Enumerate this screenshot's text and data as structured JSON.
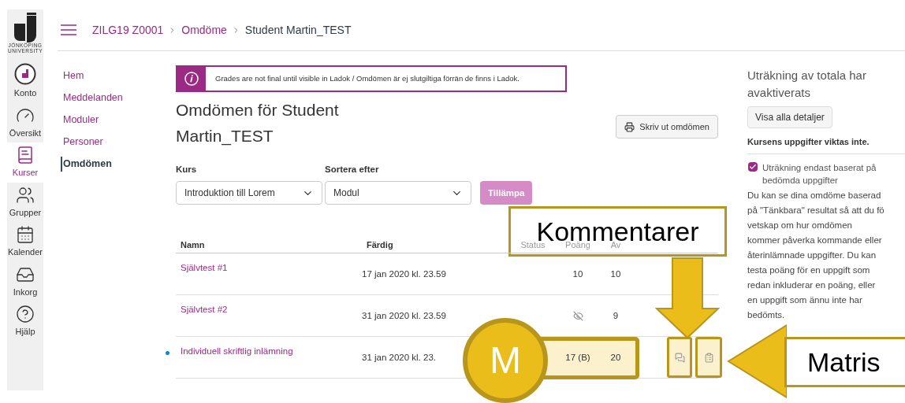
{
  "logo": {
    "lines": [
      "JÖNKÖPING",
      "UNIVERSITY"
    ]
  },
  "global_nav": [
    {
      "label": "Konto",
      "kind": "account",
      "selected": false
    },
    {
      "label": "Översikt",
      "kind": "dashboard",
      "selected": false
    },
    {
      "label": "Kurser",
      "kind": "courses",
      "selected": true
    },
    {
      "label": "Grupper",
      "kind": "groups",
      "selected": false
    },
    {
      "label": "Kalender",
      "kind": "calendar",
      "selected": false
    },
    {
      "label": "Inkorg",
      "kind": "inbox",
      "selected": false
    },
    {
      "label": "Hjälp",
      "kind": "help",
      "selected": false
    }
  ],
  "breadcrumb": [
    {
      "label": "ZILG19 Z0001",
      "link": true
    },
    {
      "label": "Omdöme",
      "link": true
    },
    {
      "label": "Student Martin_TEST",
      "link": false
    }
  ],
  "course_nav": [
    {
      "label": "Hem",
      "selected": false
    },
    {
      "label": "Meddelanden",
      "selected": false
    },
    {
      "label": "Moduler",
      "selected": false
    },
    {
      "label": "Personer",
      "selected": false
    },
    {
      "label": "Omdömen",
      "selected": true
    }
  ],
  "banner": {
    "text": "Grades are not final until visible in Ladok / Omdömen är ej slutgiltiga förrän de finns i Ladok."
  },
  "title": "Omdömen för Student Martin_TEST",
  "print_button": "Skriv ut omdömen",
  "filters": [
    {
      "label": "Kurs",
      "value": "Introduktion till Lorem"
    },
    {
      "label": "Sortera efter",
      "value": "Modul"
    }
  ],
  "apply_button": "Tillämpa",
  "table": {
    "columns": [
      "Namn",
      "Färdig",
      "Status",
      "Poäng",
      "Av"
    ],
    "rows": [
      {
        "name": "Självtest #1",
        "due": "17 jan 2020 kl. 23.59",
        "kind": "text",
        "score": "10",
        "out_of": "10",
        "unread": false,
        "highlighted": false,
        "icons": false
      },
      {
        "name": "Självtest #2",
        "due": "31 jan 2020 kl. 23.59",
        "kind": "hidden",
        "out_of": "9",
        "unread": false,
        "highlighted": false,
        "icons": false
      },
      {
        "name": "Individuell skriftlig inlämning",
        "due": "31 jan 2020 kl. 23.",
        "kind": "text",
        "score": "17 (B)",
        "out_of": "20",
        "unread": true,
        "highlighted": true,
        "icons": true
      }
    ]
  },
  "sidebar": {
    "heading": "Uträkning av totala har avaktiverats",
    "details_button": "Visa alla detaljer",
    "weight_note": "Kursens uppgifter viktas inte.",
    "checkbox": {
      "label": "Uträkning endast baserat på bedömda uppgifter",
      "checked": true
    },
    "paragraph_lines": [
      "Du kan se dina omdöme baserad",
      "på \"Tänkbara\" resultat så att du fö",
      "vetskap om hur omdömen",
      "kommer påverka kommande eller",
      "återinlämnade uppgifter. Du kan",
      "testa poäng för en uppgift som",
      "redan inkluderar en poäng, eller",
      "en uppgift som ännu inte har",
      "bedömts."
    ]
  },
  "annotations": {
    "comments_label": "Kommentarer",
    "matrix_label": "Matris",
    "circle_letter": "M"
  }
}
